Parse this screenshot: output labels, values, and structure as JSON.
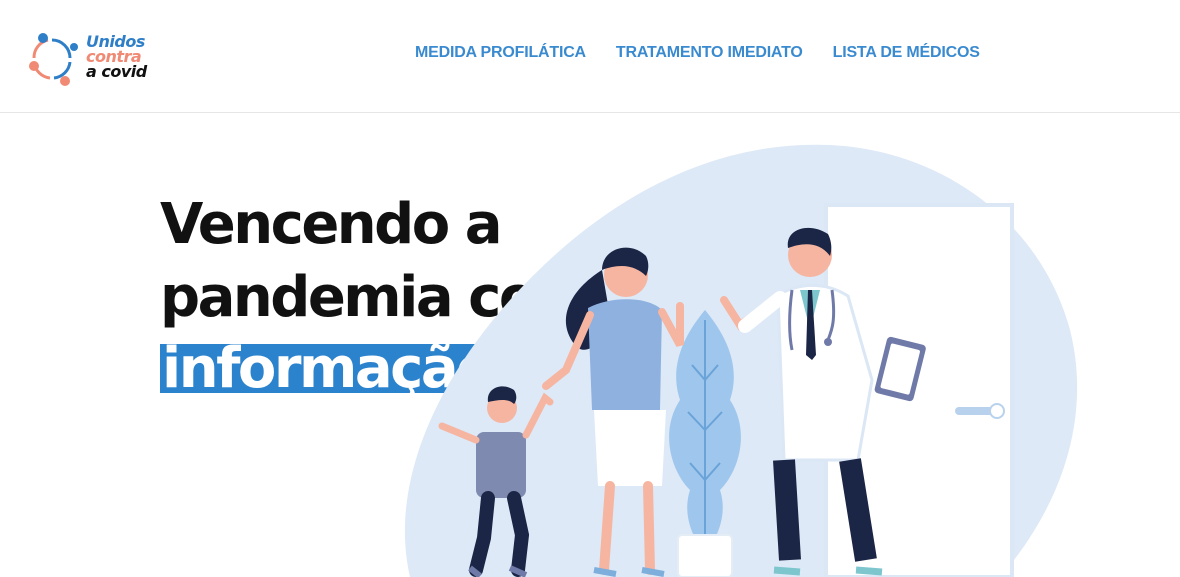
{
  "logo": {
    "line1": "Unidos",
    "line2": "contra",
    "line3": "a covid"
  },
  "nav": {
    "items": [
      {
        "label": "MEDIDA PROFILÁTICA"
      },
      {
        "label": "TRATAMENTO IMEDIATO"
      },
      {
        "label": "LISTA DE MÉDICOS"
      }
    ]
  },
  "hero": {
    "line1": "Vencendo a",
    "line2": "pandemia com",
    "highlight": "informação"
  },
  "colors": {
    "accent": "#2c83cd",
    "nav": "#3a8ad0",
    "blob": "#dde9f7",
    "logo_coral": "#f08a75"
  }
}
